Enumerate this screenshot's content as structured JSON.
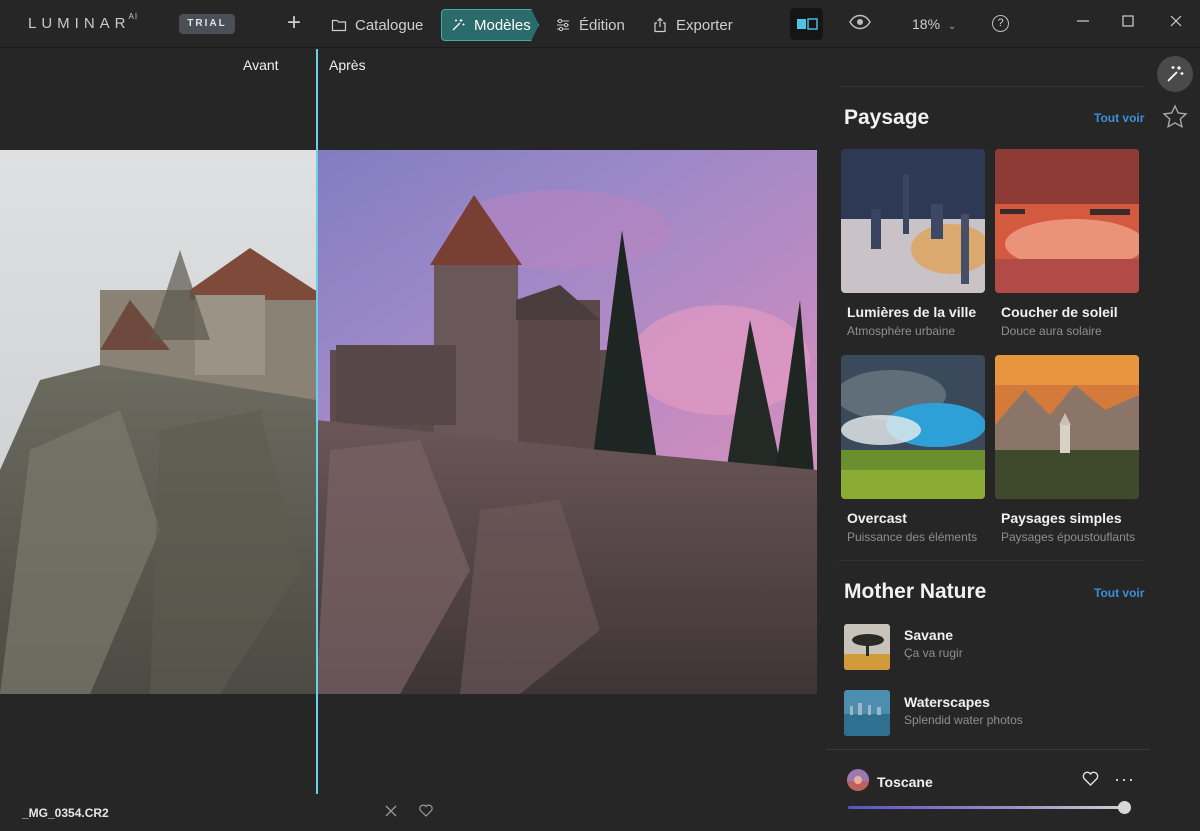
{
  "app": {
    "logo": "LUMINAR",
    "logo_sup": "AI",
    "trial_badge": "TRIAL"
  },
  "nav": {
    "add": "+",
    "catalogue": "Catalogue",
    "modeles": "Modèles",
    "edition": "Édition",
    "exporter": "Exporter"
  },
  "toolbar": {
    "zoom": "18%",
    "help": "?"
  },
  "canvas": {
    "before_label": "Avant",
    "after_label": "Après",
    "filename": "_MG_0354.CR2"
  },
  "panel": {
    "section1": {
      "title": "Paysage",
      "see_all": "Tout voir",
      "cards": [
        {
          "title": "Lumières de la ville",
          "subtitle": "Atmosphère urbaine"
        },
        {
          "title": "Coucher de soleil",
          "subtitle": "Douce aura solaire"
        },
        {
          "title": "Overcast",
          "subtitle": "Puissance des éléments"
        },
        {
          "title": "Paysages simples",
          "subtitle": "Paysages époustouflants"
        }
      ]
    },
    "section2": {
      "title": "Mother Nature",
      "see_all": "Tout voir",
      "items": [
        {
          "title": "Savane",
          "subtitle": "Ça va rugir"
        },
        {
          "title": "Waterscapes",
          "subtitle": "Splendid water photos"
        }
      ]
    },
    "applied": {
      "name": "Toscane",
      "more": "···",
      "amount": 1.0
    }
  },
  "icons": {
    "plus": "plus-icon",
    "catalogue": "folder-icon",
    "modeles": "magic-wand-icon",
    "edition": "sliders-icon",
    "exporter": "share-icon",
    "compare": "compare-split-icon",
    "eye": "eye-icon",
    "help": "help-icon",
    "favorite": "heart-icon",
    "reject": "close-icon",
    "star": "star-icon"
  },
  "colors": {
    "accent": "#4aa9a6",
    "link": "#3b8fd9",
    "divider": "#6ad0e6"
  }
}
